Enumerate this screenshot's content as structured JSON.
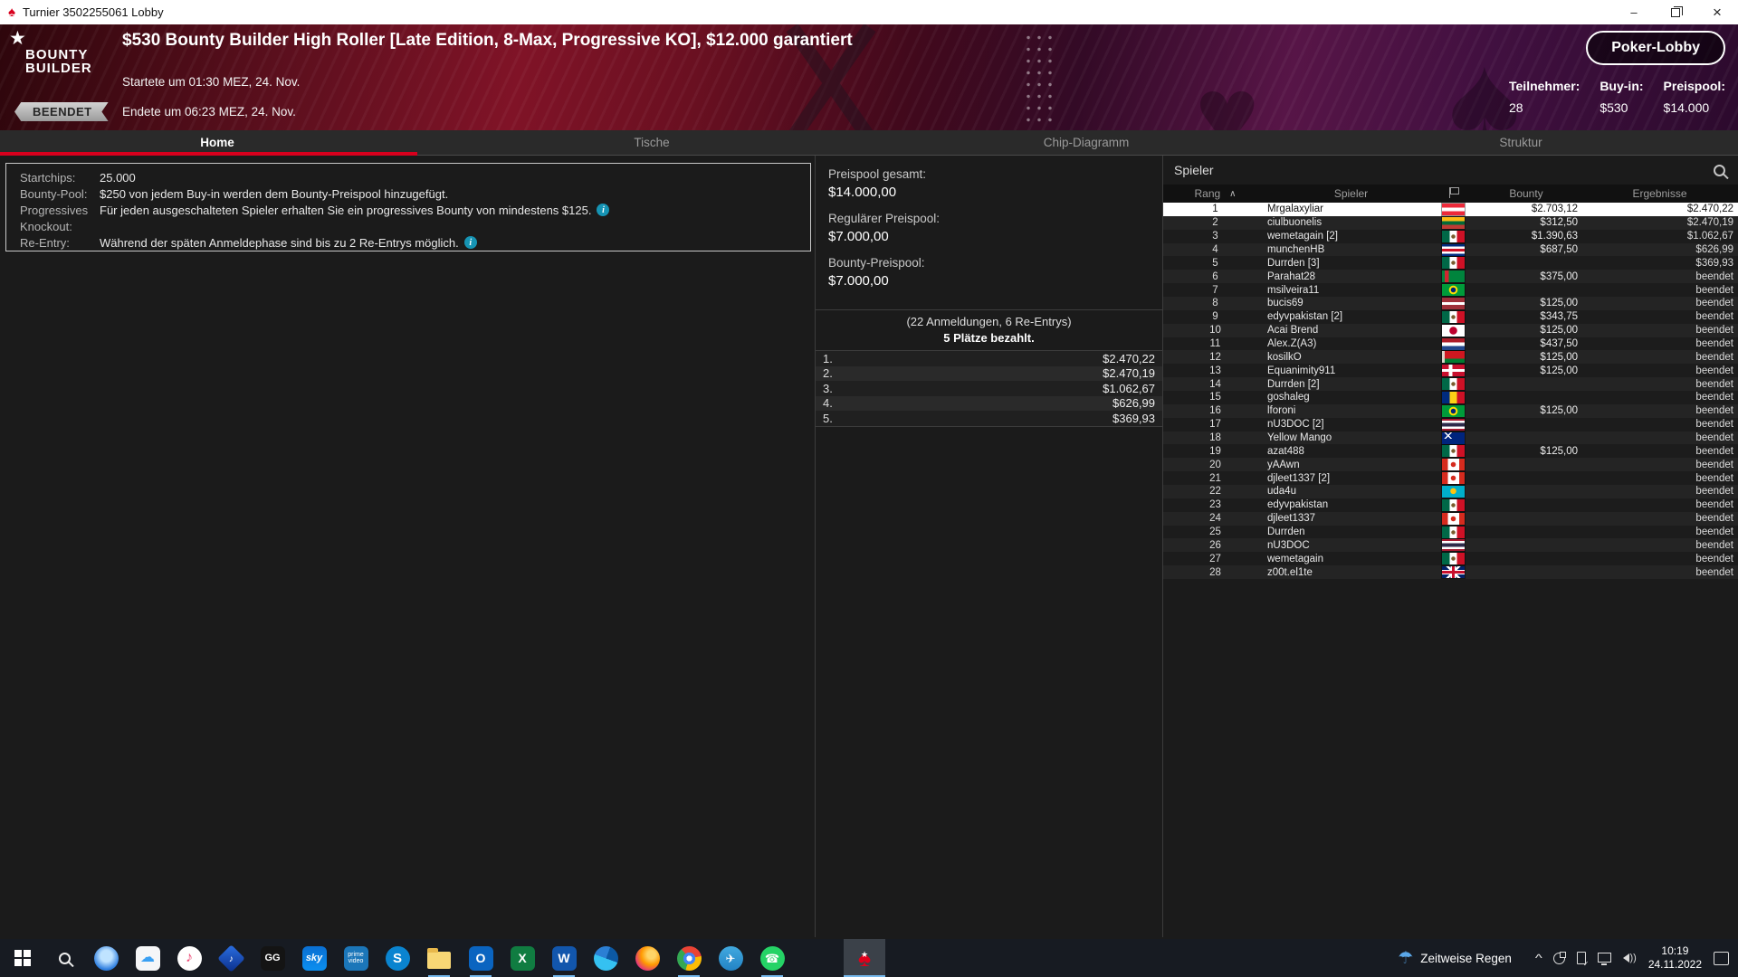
{
  "window": {
    "title": "Turnier 3502255061 Lobby"
  },
  "header": {
    "logo_line1": "BOUNTY",
    "logo_line2": "BUILDER",
    "status_badge": "BEENDET",
    "title": "$530 Bounty Builder High Roller [Late Edition, 8-Max, Progressive KO], $12.000 garantiert",
    "started": "Startete um 01:30 MEZ, 24. Nov.",
    "ended": "Endete um 06:23 MEZ, 24. Nov.",
    "lobby_button": "Poker-Lobby",
    "stats": [
      {
        "label": "Teilnehmer:",
        "value": "28"
      },
      {
        "label": "Buy-in:",
        "value": "$530"
      },
      {
        "label": "Preispool:",
        "value": "$14.000"
      }
    ]
  },
  "tabs": [
    {
      "label": "Home",
      "active": true
    },
    {
      "label": "Tische",
      "active": false
    },
    {
      "label": "Chip-Diagramm",
      "active": false
    },
    {
      "label": "Struktur",
      "active": false
    }
  ],
  "info_panel": {
    "rows": [
      {
        "label": "Startchips:",
        "text": "25.000",
        "info": false
      },
      {
        "label": "Bounty-Pool:",
        "text": "$250 von jedem Buy-in werden dem Bounty-Preispool hinzugefügt.",
        "info": false
      },
      {
        "label": "Progressives",
        "text": "Für jeden ausgeschalteten Spieler erhalten Sie ein progressives Bounty von mindestens $125.",
        "info": true
      },
      {
        "label": "Knockout:",
        "text": "",
        "info": false
      },
      {
        "label": "Re-Entry:",
        "text": "Während der späten Anmeldephase sind bis zu 2 Re-Entrys möglich.",
        "info": true
      }
    ]
  },
  "prize_panel": {
    "pools": [
      {
        "label": "Preispool gesamt:",
        "value": "$14.000,00"
      },
      {
        "label": "Regulärer Preispool:",
        "value": "$7.000,00"
      },
      {
        "label": "Bounty-Preispool:",
        "value": "$7.000,00"
      }
    ],
    "entries_note": "(22 Anmeldungen, 6 Re-Entrys)",
    "places_paid": "5 Plätze bezahlt.",
    "payouts": [
      {
        "place": "1.",
        "amount": "$2.470,22"
      },
      {
        "place": "2.",
        "amount": "$2.470,19"
      },
      {
        "place": "3.",
        "amount": "$1.062,67"
      },
      {
        "place": "4.",
        "amount": "$626,99"
      },
      {
        "place": "5.",
        "amount": "$369,93"
      }
    ]
  },
  "players_panel": {
    "title": "Spieler",
    "columns": {
      "rank": "Rang",
      "player": "Spieler",
      "bounty": "Bounty",
      "results": "Ergebnisse"
    },
    "rows": [
      {
        "rank": "1",
        "name": "Mrgalaxyliar",
        "flag": "austria",
        "bounty": "$2.703,12",
        "result": "$2.470,22",
        "highlight": true
      },
      {
        "rank": "2",
        "name": "ciulbuonelis",
        "flag": "lithuania",
        "bounty": "$312,50",
        "result": "$2.470,19"
      },
      {
        "rank": "3",
        "name": "wemetagain [2]",
        "flag": "mexico",
        "bounty": "$1.390,63",
        "result": "$1.062,67"
      },
      {
        "rank": "4",
        "name": "munchenHB",
        "flag": "costa-rica",
        "bounty": "$687,50",
        "result": "$626,99"
      },
      {
        "rank": "5",
        "name": "Durrden [3]",
        "flag": "mexico",
        "bounty": "",
        "result": "$369,93"
      },
      {
        "rank": "6",
        "name": "Parahat28",
        "flag": "turkmenistan",
        "bounty": "$375,00",
        "result": "beendet"
      },
      {
        "rank": "7",
        "name": "msilveira11",
        "flag": "brazil",
        "bounty": "",
        "result": "beendet"
      },
      {
        "rank": "8",
        "name": "bucis69",
        "flag": "latvia",
        "bounty": "$125,00",
        "result": "beendet"
      },
      {
        "rank": "9",
        "name": "edyvpakistan [2]",
        "flag": "mexico",
        "bounty": "$343,75",
        "result": "beendet"
      },
      {
        "rank": "10",
        "name": "Acai Brend",
        "flag": "japan",
        "bounty": "$125,00",
        "result": "beendet"
      },
      {
        "rank": "11",
        "name": "Alex.Z(A3)",
        "flag": "netherlands",
        "bounty": "$437,50",
        "result": "beendet"
      },
      {
        "rank": "12",
        "name": "kosilkO",
        "flag": "belarus",
        "bounty": "$125,00",
        "result": "beendet"
      },
      {
        "rank": "13",
        "name": "Equanimity911",
        "flag": "denmark",
        "bounty": "$125,00",
        "result": "beendet"
      },
      {
        "rank": "14",
        "name": "Durrden [2]",
        "flag": "mexico",
        "bounty": "",
        "result": "beendet"
      },
      {
        "rank": "15",
        "name": "goshaleg",
        "flag": "romania",
        "bounty": "",
        "result": "beendet"
      },
      {
        "rank": "16",
        "name": "lforoni",
        "flag": "brazil",
        "bounty": "$125,00",
        "result": "beendet"
      },
      {
        "rank": "17",
        "name": "nU3DOC [2]",
        "flag": "thailand",
        "bounty": "",
        "result": "beendet"
      },
      {
        "rank": "18",
        "name": "Yellow Mango",
        "flag": "australia",
        "bounty": "",
        "result": "beendet"
      },
      {
        "rank": "19",
        "name": "azat488",
        "flag": "mexico",
        "bounty": "$125,00",
        "result": "beendet"
      },
      {
        "rank": "20",
        "name": "yAAwn",
        "flag": "canada",
        "bounty": "",
        "result": "beendet"
      },
      {
        "rank": "21",
        "name": "djleet1337 [2]",
        "flag": "canada",
        "bounty": "",
        "result": "beendet"
      },
      {
        "rank": "22",
        "name": "uda4u",
        "flag": "kazakhstan",
        "bounty": "",
        "result": "beendet"
      },
      {
        "rank": "23",
        "name": "edyvpakistan",
        "flag": "mexico",
        "bounty": "",
        "result": "beendet"
      },
      {
        "rank": "24",
        "name": "djleet1337",
        "flag": "canada",
        "bounty": "",
        "result": "beendet"
      },
      {
        "rank": "25",
        "name": "Durrden",
        "flag": "mexico",
        "bounty": "",
        "result": "beendet"
      },
      {
        "rank": "26",
        "name": "nU3DOC",
        "flag": "thailand",
        "bounty": "",
        "result": "beendet"
      },
      {
        "rank": "27",
        "name": "wemetagain",
        "flag": "mexico",
        "bounty": "",
        "result": "beendet"
      },
      {
        "rank": "28",
        "name": "z00t.el1te",
        "flag": "uk",
        "bounty": "",
        "result": "beendet"
      }
    ]
  },
  "flags": {
    "austria": "linear-gradient(180deg,#ED2939 0 33%,#fff 33% 66%,#ED2939 66% 100%)",
    "lithuania": "linear-gradient(180deg,#FDB913 0 33%,#046A38 33% 66%,#BE3A34 66% 100%)",
    "mexico": "radial-gradient(circle at 50% 50%, #7a5c2e 0 2px, transparent 2.5px), linear-gradient(90deg,#006847 0 33%,#fff 33% 66%,#CE1126 66% 100%)",
    "costa-rica": "linear-gradient(180deg,#002B7F 0 18%,#fff 18% 37%,#CE1126 37% 63%,#fff 63% 82%,#002B7F 82% 100%)",
    "turkmenistan": "linear-gradient(90deg,#00843D 0 12%,#D22630 12% 30%,#00843D 30% 100%)",
    "brazil": "radial-gradient(circle at 50% 50%, #002776 0 2.5px, transparent 3px), radial-gradient(circle at 50% 50%, #FEDF00 0 4.5px, transparent 5px), #009B3A",
    "latvia": "linear-gradient(180deg,#9E3039 0 40%,#fff 40% 60%,#9E3039 60% 100%)",
    "japan": "radial-gradient(circle at 50% 50%, #BC002D 0 4px, transparent 4.5px), #fff",
    "netherlands": "linear-gradient(180deg,#AE1C28 0 33%,#fff 33% 66%,#21468B 66% 100%)",
    "belarus": "linear-gradient(90deg,#ddd0c8 0 12%, transparent 12%), linear-gradient(180deg,#CE1720 0 66%,#007C30 66% 100%)",
    "denmark": "linear-gradient(90deg, transparent 0 30%, #fff 30% 45%, transparent 45% 100%), linear-gradient(180deg, transparent 0 38%, #fff 38% 62%, transparent 62% 100%), #C8102E",
    "romania": "linear-gradient(90deg,#002B7F 0 33%,#FCD116 33% 66%,#CE1126 66% 100%)",
    "thailand": "linear-gradient(180deg,#A51931 0 17%,#fff 17% 33%,#2D2A4A 33% 67%,#fff 67% 83%,#A51931 83% 100%)",
    "australia": "linear-gradient(135deg, transparent 0 45%, #fff 45% 55%, transparent 55% 100%) no-repeat 0 0/55% 55%, linear-gradient(45deg, transparent 0 45%, #fff 45% 55%, transparent 55% 100%) no-repeat 0 0/55% 55%, #00247D",
    "canada": "radial-gradient(circle at 50% 50%, #D52B1E 0 2.5px, transparent 3px), linear-gradient(90deg,#D52B1E 0 25%,#fff 25% 75%,#D52B1E 75% 100%)",
    "kazakhstan": "radial-gradient(circle at 50% 45%, #FEC50C 0 3px, transparent 3.5px), #00AFCA",
    "uk": "linear-gradient(90deg, transparent 0 44%, #C8102E 44% 56%, transparent 56% 100%), linear-gradient(180deg, transparent 0 40%, #C8102E 40% 60%, transparent 60% 100%), linear-gradient(90deg, transparent 0 38%, #fff 38% 62%, transparent 62% 100%), linear-gradient(180deg, transparent 0 32%, #fff 32% 68%, transparent 68% 100%), linear-gradient(135deg, transparent 0 46%, #fff 46% 54%, transparent 54% 100%), linear-gradient(45deg, transparent 0 46%, #fff 46% 54%, transparent 54% 100%), #012169"
  },
  "taskbar": {
    "apps": [
      {
        "name": "start-button",
        "type": "win"
      },
      {
        "name": "search-button",
        "type": "magnifier"
      },
      {
        "name": "messages-app-icon",
        "type": "app",
        "shape": "circle",
        "bg": "radial-gradient(circle at 50% 40%, #bfe3ff 0 30%, #2f7fe0 70%)",
        "text": ""
      },
      {
        "name": "icloud-app-icon",
        "type": "app",
        "shape": "rounded",
        "bg": "#f5f6f8",
        "text": "☁",
        "fg": "#3aa0f3",
        "fs": 16
      },
      {
        "name": "itunes-app-icon",
        "type": "app",
        "shape": "circle",
        "bg": "#ffffff",
        "text": "♪",
        "fg": "#ec4874",
        "fs": 16
      },
      {
        "name": "music-app-icon",
        "type": "app",
        "shape": "diamond",
        "bg": "linear-gradient(135deg,#2b6fe3,#0b2f8a)",
        "text": "♪",
        "fg": "#fff",
        "fs": 13
      },
      {
        "name": "ggpoker-app-icon",
        "type": "app",
        "shape": "rounded",
        "bg": "#141414",
        "text": "GG",
        "fg": "#fff",
        "fs": 11,
        "bold": true
      },
      {
        "name": "sky-app-icon",
        "type": "app",
        "shape": "rounded",
        "bg": "linear-gradient(180deg,#0a6fd2,#0b8ff0)",
        "text": "sky",
        "fg": "#fff",
        "fs": 11,
        "bold": true,
        "italic": true
      },
      {
        "name": "prime-video-app-icon",
        "type": "app",
        "shape": "rounded",
        "bg": "#1b76b9",
        "text": "prime\nvideo",
        "fg": "#fff",
        "fs": 7
      },
      {
        "name": "skype-app-icon",
        "type": "app",
        "shape": "circle",
        "bg": "#0a84d0",
        "text": "S",
        "fg": "#fff",
        "fs": 15,
        "bold": true
      },
      {
        "name": "file-explorer-icon",
        "type": "folder",
        "running": true
      },
      {
        "name": "outlook-app-icon",
        "type": "app",
        "shape": "rounded",
        "bg": "#0a64c0",
        "text": "O",
        "fg": "#fff",
        "fs": 14,
        "bold": true,
        "running": true
      },
      {
        "name": "excel-app-icon",
        "type": "app",
        "shape": "rounded",
        "bg": "#107C41",
        "text": "X",
        "fg": "#fff",
        "fs": 14,
        "bold": true
      },
      {
        "name": "word-app-icon",
        "type": "app",
        "shape": "rounded",
        "bg": "#1256ac",
        "text": "W",
        "fg": "#fff",
        "fs": 14,
        "bold": true,
        "running": true
      },
      {
        "name": "edge-app-icon",
        "type": "app",
        "shape": "circle",
        "bg": "conic-gradient(from 200deg, #35c1f1 0 25%, #2b7fd4 25% 50%, #0c59a4 50% 75%, #35c1f1 75% 100%)",
        "text": ""
      },
      {
        "name": "firefox-app-icon",
        "type": "app",
        "shape": "circle",
        "bg": "radial-gradient(circle at 65% 35%, #ffd567 0 18%, #ff9a00 45%, #e3367b 75%, #90059e 100%)",
        "text": ""
      },
      {
        "name": "chrome-app-icon",
        "type": "app",
        "shape": "circle",
        "bg": "radial-gradient(circle at 50% 50%, #fff 0 16%, #4285f4 17% 34%, transparent 35%), conic-gradient(from -40deg, #ea4335 0 33%, #fbbc05 33% 66%, #34a853 66% 100%)",
        "text": "",
        "running": true
      },
      {
        "name": "telegram-app-icon",
        "type": "app",
        "shape": "circle",
        "bg": "linear-gradient(180deg,#41a9e0,#2383c4)",
        "text": "✈",
        "fg": "#fff",
        "fs": 13
      },
      {
        "name": "whatsapp-app-icon",
        "type": "app",
        "shape": "circle",
        "bg": "#25d366",
        "text": "☎",
        "fg": "#fff",
        "fs": 13,
        "running": true
      },
      {
        "name": "pokerstars-app-icon",
        "type": "pokerstars",
        "active": true,
        "running": true,
        "gap": 56
      }
    ],
    "weather": {
      "icon": "umbrella-rain-icon",
      "label": "Zeitweise Regen"
    },
    "tray": [
      "tray-chevron-icon",
      "tray-sync-icon",
      "tray-usb-icon",
      "tray-network-icon",
      "tray-volume-icon"
    ],
    "clock": {
      "time": "10:19",
      "date": "24.11.2022"
    }
  },
  "icons": {
    "titlebar-spade": "♠",
    "favorite-star": "★",
    "minimize": "–",
    "close": "×",
    "sort-caret-up": "∧",
    "info": "i",
    "pokerstars-spade": "♠",
    "pokerstars-star": "★",
    "umbrella": "☂",
    "header-suit-spade": "♠",
    "header-suit-heart": "♥"
  },
  "colors": {
    "accent_red": "#d8001d",
    "info_icon": "#1694b4",
    "highlight_row": "#ffffff",
    "running_indicator": "#76b9ed",
    "taskbar_bg": "#171b22",
    "badge_silver": "#c2c2c2"
  }
}
